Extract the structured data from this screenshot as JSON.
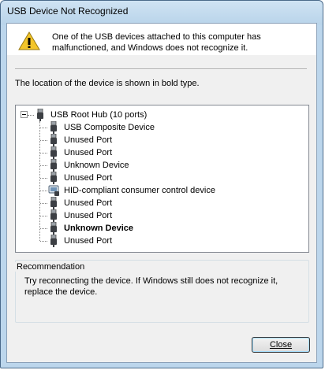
{
  "window": {
    "title": "USB Device Not Recognized"
  },
  "header": {
    "message": "One of the USB devices attached to this computer has malfunctioned, and Windows does not recognize it."
  },
  "location_text": "The location of the device is shown in bold type.",
  "tree": {
    "root": {
      "label": "USB Root Hub (10 ports)",
      "icon": "usb-plug-icon"
    },
    "children": [
      {
        "label": "USB Composite Device",
        "icon": "usb-plug-icon",
        "bold": false
      },
      {
        "label": "Unused Port",
        "icon": "usb-plug-icon",
        "bold": false
      },
      {
        "label": "Unused Port",
        "icon": "usb-plug-icon",
        "bold": false
      },
      {
        "label": "Unknown Device",
        "icon": "usb-plug-icon",
        "bold": false
      },
      {
        "label": "Unused Port",
        "icon": "usb-plug-icon",
        "bold": false
      },
      {
        "label": "HID-compliant consumer control device",
        "icon": "hid-device-icon",
        "bold": false
      },
      {
        "label": "Unused Port",
        "icon": "usb-plug-icon",
        "bold": false
      },
      {
        "label": "Unused Port",
        "icon": "usb-plug-icon",
        "bold": false
      },
      {
        "label": "Unknown Device",
        "icon": "usb-plug-icon",
        "bold": true
      },
      {
        "label": "Unused Port",
        "icon": "usb-plug-icon",
        "bold": false
      }
    ]
  },
  "recommendation": {
    "title": "Recommendation",
    "text": "Try reconnecting the device. If Windows still does not recognize it, replace the device."
  },
  "buttons": {
    "close": "Close"
  },
  "colors": {
    "warning": "#f3c52a",
    "titlebar": "#bcd6ec"
  }
}
